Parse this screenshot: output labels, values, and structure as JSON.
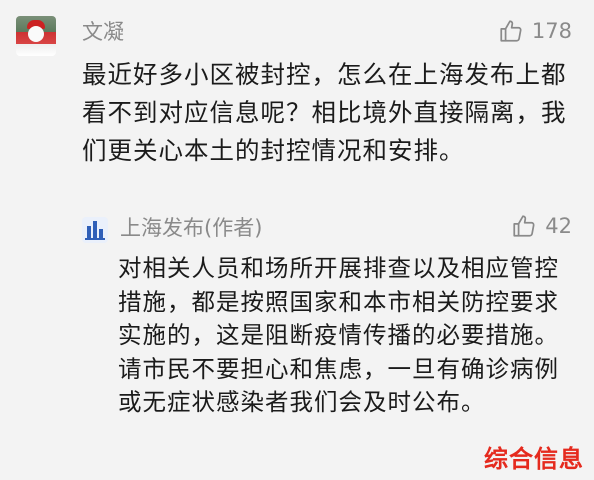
{
  "comment": {
    "user_name": "文凝",
    "likes": "178",
    "text": "最近好多小区被封控，怎么在上海发布上都看不到对应信息呢？相比境外直接隔离，我们更关心本土的封控情况和安排。"
  },
  "reply": {
    "user_name": "上海发布(作者)",
    "likes": "42",
    "text": "对相关人员和场所开展排查以及相应管控措施，都是按照国家和本市相关防控要求实施的，这是阻断疫情传播的必要措施。请市民不要担心和焦虑，一旦有确诊病例或无症状感染者我们会及时公布。"
  },
  "watermark": "综合信息",
  "icons": {
    "like": "thumbs-up-outline-icon",
    "author_avatar": "shanghai-skyline-logo"
  },
  "colors": {
    "meta_gray": "#8a8a8a",
    "body_text": "#1b1b1b",
    "watermark_red": "#e52a1e",
    "background": "#f3f3f3"
  }
}
